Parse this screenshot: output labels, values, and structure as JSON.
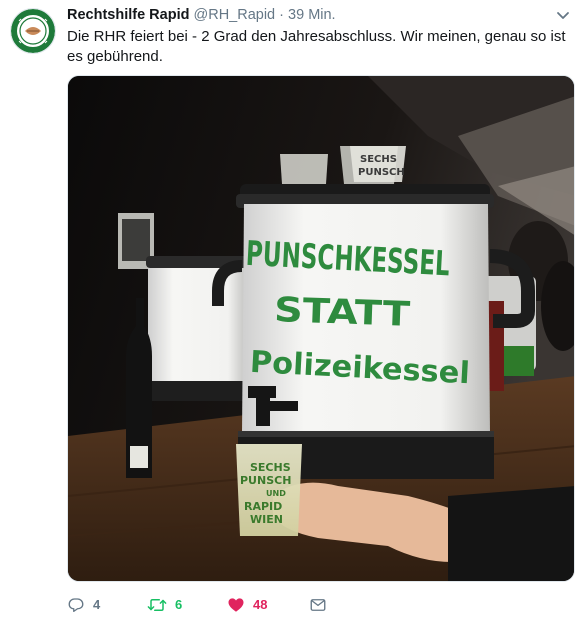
{
  "tweet": {
    "display_name": "Rechtshilfe Rapid",
    "handle": "@RH_Rapid",
    "separator": "·",
    "time": "39 Min.",
    "text": "Die RHR feiert bei - 2 Grad den Jahresabschluss. Wir meinen, genau so ist es gebührend.",
    "avatar_text": "RECHTSHILFE RAPID"
  },
  "photo": {
    "kettle_text_1": "PUNSCHKESSEL",
    "kettle_text_2": "STATT",
    "kettle_text_3": "Polizeikessel",
    "cup_text_1": "SECHS",
    "cup_text_2": "PUNSCH",
    "cup_text_3": "UND",
    "cup_text_4": "RAPID",
    "cup_text_5": "WIEN",
    "top_cup_text_1": "SECHS",
    "top_cup_text_2": "PUNSCH"
  },
  "actions": {
    "reply_count": "4",
    "retweet_count": "6",
    "like_count": "48"
  },
  "colors": {
    "retweet": "#17bf63",
    "like": "#e0245e",
    "secondary_text": "#657786",
    "marker_green": "#2e8b3e"
  },
  "icons": [
    "reply-icon",
    "retweet-icon",
    "heart-icon",
    "direct-message-icon",
    "chevron-down-icon"
  ]
}
